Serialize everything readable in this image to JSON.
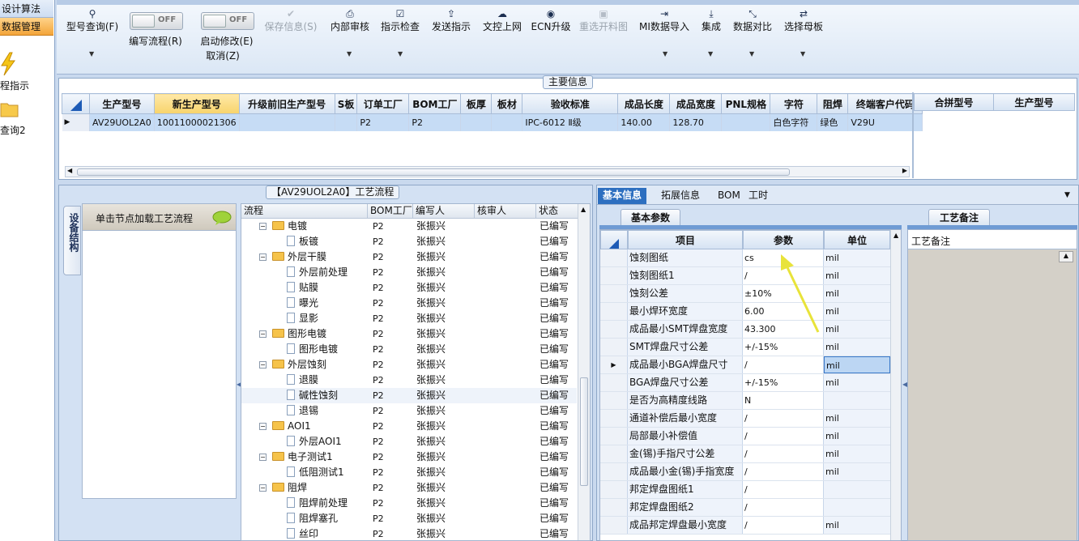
{
  "nav": {
    "items": [
      "设计算法",
      "数据管理",
      "程指示",
      "查询2"
    ]
  },
  "toolbar": {
    "buttons": [
      {
        "label": "型号查询(F)",
        "icon": "search-icon",
        "enabled": true,
        "dropdown": true
      },
      {
        "label": "保存信息(S)",
        "icon": "check-icon",
        "enabled": false
      },
      {
        "label": "内部审核",
        "icon": "printer-icon",
        "enabled": true,
        "dropdown": true
      },
      {
        "label": "指示检查",
        "icon": "checkbox-icon",
        "enabled": true,
        "dropdown": true
      },
      {
        "label": "发送指示",
        "icon": "upload-icon",
        "enabled": true
      },
      {
        "label": "文控上网",
        "icon": "cloud-upload-icon",
        "enabled": true
      },
      {
        "label": "ECN升级",
        "icon": "binoculars-icon",
        "enabled": true
      },
      {
        "label": "重选开料图",
        "icon": "image-icon",
        "enabled": false
      },
      {
        "label": "MI数据导入",
        "icon": "import-icon",
        "enabled": true,
        "dropdown": true
      },
      {
        "label": "集成",
        "icon": "download-icon",
        "enabled": true,
        "dropdown": true
      },
      {
        "label": "数据对比",
        "icon": "compress-icon",
        "enabled": true,
        "dropdown": true
      },
      {
        "label": "选择母板",
        "icon": "shuffle-icon",
        "enabled": true,
        "dropdown": true
      }
    ],
    "toggles": [
      {
        "label": "编写流程(R)",
        "state": "OFF"
      },
      {
        "label": "启动修改(E)",
        "state": "OFF",
        "extra": "取消(Z)"
      }
    ]
  },
  "main": {
    "title": "主要信息",
    "columns": [
      "生产型号",
      "新生产型号",
      "升级前旧生产型号",
      "S板",
      "订单工厂",
      "BOM工厂",
      "板厚",
      "板材",
      "验收标准",
      "成品长度",
      "成品宽度",
      "PNL规格",
      "字符",
      "阻焊",
      "终端客户代码"
    ],
    "row": [
      "AV29UOL2A0",
      "10011000021306",
      "",
      "",
      "P2",
      "P2",
      "",
      "",
      "IPC-6012 Ⅱ级",
      "140.00",
      "128.70",
      "",
      "白色字符",
      "绿色",
      "V29U"
    ],
    "side_columns": [
      "合拼型号",
      "生产型号"
    ]
  },
  "process": {
    "title": "【AV29UOL2A0】工艺流程",
    "side_tab": "设备结构",
    "node_hint": "单击节点加载工艺流程",
    "columns": [
      "流程",
      "BOM工厂",
      "编写人",
      "核审人",
      "状态"
    ],
    "rows": [
      {
        "name": "电镀",
        "level": 0,
        "factory": "P2",
        "writer": "张振兴",
        "reviewer": "",
        "status": "已编写"
      },
      {
        "name": "板镀",
        "level": 1,
        "factory": "P2",
        "writer": "张振兴",
        "reviewer": "",
        "status": "已编写"
      },
      {
        "name": "外层干膜",
        "level": 0,
        "factory": "P2",
        "writer": "张振兴",
        "reviewer": "",
        "status": "已编写"
      },
      {
        "name": "外层前处理",
        "level": 1,
        "factory": "P2",
        "writer": "张振兴",
        "reviewer": "",
        "status": "已编写"
      },
      {
        "name": "贴膜",
        "level": 1,
        "factory": "P2",
        "writer": "张振兴",
        "reviewer": "",
        "status": "已编写"
      },
      {
        "name": "曝光",
        "level": 1,
        "factory": "P2",
        "writer": "张振兴",
        "reviewer": "",
        "status": "已编写"
      },
      {
        "name": "显影",
        "level": 1,
        "factory": "P2",
        "writer": "张振兴",
        "reviewer": "",
        "status": "已编写"
      },
      {
        "name": "图形电镀",
        "level": 0,
        "factory": "P2",
        "writer": "张振兴",
        "reviewer": "",
        "status": "已编写"
      },
      {
        "name": "图形电镀",
        "level": 1,
        "factory": "P2",
        "writer": "张振兴",
        "reviewer": "",
        "status": "已编写"
      },
      {
        "name": "外层蚀刻",
        "level": 0,
        "factory": "P2",
        "writer": "张振兴",
        "reviewer": "",
        "status": "已编写"
      },
      {
        "name": "退膜",
        "level": 1,
        "factory": "P2",
        "writer": "张振兴",
        "reviewer": "",
        "status": "已编写"
      },
      {
        "name": "碱性蚀刻",
        "level": 1,
        "factory": "P2",
        "writer": "张振兴",
        "reviewer": "",
        "status": "已编写"
      },
      {
        "name": "退锡",
        "level": 1,
        "factory": "P2",
        "writer": "张振兴",
        "reviewer": "",
        "status": "已编写"
      },
      {
        "name": "AOI1",
        "level": 0,
        "factory": "P2",
        "writer": "张振兴",
        "reviewer": "",
        "status": "已编写"
      },
      {
        "name": "外层AOI1",
        "level": 1,
        "factory": "P2",
        "writer": "张振兴",
        "reviewer": "",
        "status": "已编写"
      },
      {
        "name": "电子测试1",
        "level": 0,
        "factory": "P2",
        "writer": "张振兴",
        "reviewer": "",
        "status": "已编写"
      },
      {
        "name": "低阻测试1",
        "level": 1,
        "factory": "P2",
        "writer": "张振兴",
        "reviewer": "",
        "status": "已编写"
      },
      {
        "name": "阻焊",
        "level": 0,
        "factory": "P2",
        "writer": "张振兴",
        "reviewer": "",
        "status": "已编写"
      },
      {
        "name": "阻焊前处理",
        "level": 1,
        "factory": "P2",
        "writer": "张振兴",
        "reviewer": "",
        "status": "已编写"
      },
      {
        "name": "阻焊塞孔",
        "level": 1,
        "factory": "P2",
        "writer": "张振兴",
        "reviewer": "",
        "status": "已编写"
      },
      {
        "name": "丝印",
        "level": 1,
        "factory": "P2",
        "writer": "张振兴",
        "reviewer": "",
        "status": "已编写"
      }
    ]
  },
  "info": {
    "tabs": [
      "基本信息",
      "拓展信息",
      "BOM",
      "工时"
    ],
    "subtab": "基本参数",
    "memo_tab": "工艺备注",
    "memo_header": "工艺备注",
    "columns": [
      "项目",
      "参数",
      "单位"
    ],
    "rows": [
      {
        "item": "蚀刻图纸",
        "param": "cs",
        "unit": "mil"
      },
      {
        "item": "蚀刻图纸1",
        "param": "/",
        "unit": "mil"
      },
      {
        "item": "蚀刻公差",
        "param": "±10%",
        "unit": "mil"
      },
      {
        "item": "最小焊环宽度",
        "param": "6.00",
        "unit": "mil"
      },
      {
        "item": "成品最小SMT焊盘宽度",
        "param": "43.300",
        "unit": "mil"
      },
      {
        "item": "SMT焊盘尺寸公差",
        "param": "+/-15%",
        "unit": "mil"
      },
      {
        "item": "成品最小BGA焊盘尺寸",
        "param": "/",
        "unit": "mil"
      },
      {
        "item": "BGA焊盘尺寸公差",
        "param": "+/-15%",
        "unit": "mil"
      },
      {
        "item": "是否为高精度线路",
        "param": "N",
        "unit": ""
      },
      {
        "item": "通道补偿后最小宽度",
        "param": "/",
        "unit": "mil"
      },
      {
        "item": "局部最小补偿值",
        "param": "/",
        "unit": "mil"
      },
      {
        "item": "金(锡)手指尺寸公差",
        "param": "/",
        "unit": "mil"
      },
      {
        "item": "成品最小金(锡)手指宽度",
        "param": "/",
        "unit": "mil"
      },
      {
        "item": "邦定焊盘图纸1",
        "param": "/",
        "unit": ""
      },
      {
        "item": "邦定焊盘图纸2",
        "param": "/",
        "unit": ""
      },
      {
        "item": "成品邦定焊盘最小宽度",
        "param": "/",
        "unit": "mil"
      }
    ]
  }
}
